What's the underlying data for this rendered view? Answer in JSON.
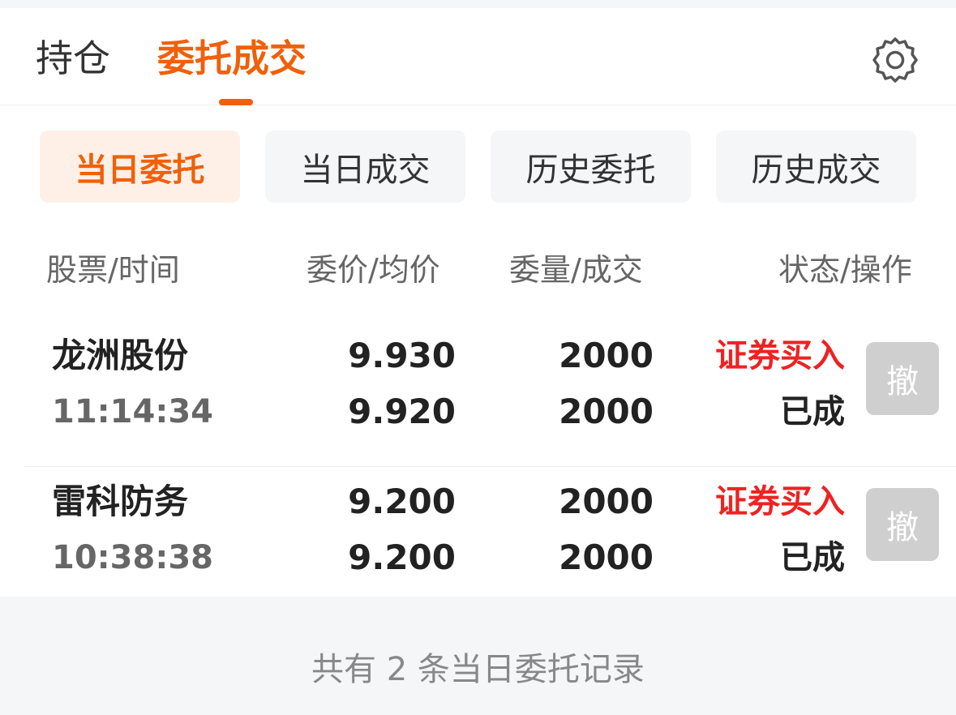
{
  "top_tabs": [
    {
      "label": "持仓",
      "active": false
    },
    {
      "label": "委托成交",
      "active": true
    }
  ],
  "icons": {
    "settings": "gear-icon"
  },
  "filters": [
    {
      "label": "当日委托",
      "active": true
    },
    {
      "label": "当日成交",
      "active": false
    },
    {
      "label": "历史委托",
      "active": false
    },
    {
      "label": "历史成交",
      "active": false
    }
  ],
  "columns": [
    "股票/时间",
    "委价/均价",
    "委量/成交",
    "状态/操作"
  ],
  "orders": [
    {
      "name": "龙洲股份",
      "time": "11:14:34",
      "order_price": "9.930",
      "avg_price": "9.920",
      "order_qty": "2000",
      "filled_qty": "2000",
      "type": "证券买入",
      "status": "已成",
      "cancel_label": "撤"
    },
    {
      "name": "雷科防务",
      "time": "10:38:38",
      "order_price": "9.200",
      "avg_price": "9.200",
      "order_qty": "2000",
      "filled_qty": "2000",
      "type": "证券买入",
      "status": "已成",
      "cancel_label": "撤"
    }
  ],
  "footer": "共有 2 条当日委托记录",
  "colors": {
    "accent": "#f0600a",
    "buy": "#ee2222",
    "disabled": "#cfcfcf"
  }
}
